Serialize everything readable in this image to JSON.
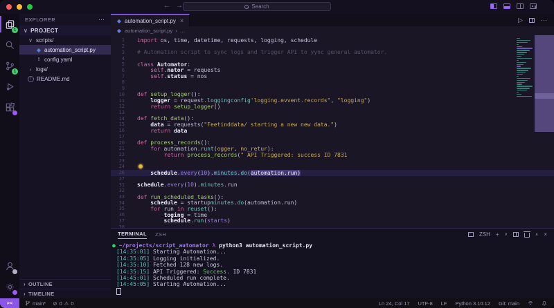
{
  "colors": {
    "accent": "#7c52d6",
    "badge_green": "#3fcf6e",
    "badge_purple": "#9a5cf0",
    "selection": "#453a74"
  },
  "titlebar": {
    "search_placeholder": "Search",
    "nav_back": "←",
    "nav_forward": "→"
  },
  "activity_bar": {
    "explorer_badge": "1",
    "scm_badge": "1"
  },
  "sidebar": {
    "title": "EXPLORER",
    "more": "⋯",
    "project_label": "PROJECT",
    "tree": [
      {
        "label": "scripts/",
        "icon": "folder-open",
        "level": 1
      },
      {
        "label": "automation_script.py",
        "icon": "python",
        "level": 2,
        "selected": true
      },
      {
        "label": "config.yaml",
        "icon": "yaml",
        "level": 2
      },
      {
        "label": "logs/",
        "icon": "folder-closed",
        "level": 1
      },
      {
        "label": "README.md",
        "icon": "info",
        "level": 1
      }
    ],
    "outline_label": "OUTLINE",
    "timeline_label": "TIMELINE"
  },
  "editor": {
    "tab": {
      "label": "automation_script.py",
      "icon": "python",
      "close": "×"
    },
    "actions": {
      "run": "▷",
      "more": "⋯"
    },
    "breadcrumb": {
      "file": "automation_script.py",
      "sep": "›",
      "tail": "…"
    },
    "code": [
      {
        "n": "1",
        "t": [
          [
            "kw",
            "import"
          ],
          [
            "tx",
            " os, time, datetime, requests, logging, schedule"
          ]
        ]
      },
      {
        "n": "2",
        "t": []
      },
      {
        "n": "3",
        "t": [
          [
            "cm",
            "# Automation script to sync logs and trigger API to yync general automator."
          ]
        ]
      },
      {
        "n": "4",
        "t": []
      },
      {
        "n": "5",
        "t": [
          [
            "kw",
            "class"
          ],
          [
            "tx",
            " "
          ],
          [
            "bd",
            "Automator"
          ],
          [
            "tx",
            ":"
          ]
        ]
      },
      {
        "n": "6",
        "t": [
          [
            "tx",
            "    "
          ],
          [
            "sf",
            "self"
          ],
          [
            "tx",
            "."
          ],
          [
            "bd",
            "nator"
          ],
          [
            "tx",
            " = requests"
          ]
        ]
      },
      {
        "n": "7",
        "t": [
          [
            "tx",
            "    "
          ],
          [
            "sf",
            "self"
          ],
          [
            "tx",
            "."
          ],
          [
            "bd",
            "status"
          ],
          [
            "tx",
            " = nos"
          ]
        ]
      },
      {
        "n": "8",
        "t": []
      },
      {
        "n": "9",
        "t": []
      },
      {
        "n": "10",
        "t": [
          [
            "kw",
            "def"
          ],
          [
            "tx",
            " "
          ],
          [
            "fn",
            "setup_logger"
          ],
          [
            "tx",
            "():"
          ]
        ]
      },
      {
        "n": "11",
        "t": [
          [
            "tx",
            "    "
          ],
          [
            "bd",
            "logger"
          ],
          [
            "tx",
            " = request."
          ],
          [
            "pr",
            "loggingconfig"
          ],
          [
            "st",
            "'logging.evvent.records\""
          ],
          [
            "tx",
            ", "
          ],
          [
            "st",
            "\"logging\""
          ],
          [
            "tx",
            ")"
          ]
        ]
      },
      {
        "n": "12",
        "t": [
          [
            "tx",
            "    "
          ],
          [
            "kw",
            "return"
          ],
          [
            "tx",
            " "
          ],
          [
            "fn",
            "setup_logger"
          ],
          [
            "tx",
            "()"
          ]
        ]
      },
      {
        "n": "13",
        "t": []
      },
      {
        "n": "14",
        "t": [
          [
            "kw",
            "def"
          ],
          [
            "tx",
            " "
          ],
          [
            "fn",
            "fetch_data"
          ],
          [
            "tx",
            "():"
          ]
        ]
      },
      {
        "n": "15",
        "t": [
          [
            "tx",
            "    "
          ],
          [
            "bd",
            "data"
          ],
          [
            "tx",
            " = requests("
          ],
          [
            "st",
            "\"Feetinddata/ starting a new new data.\""
          ],
          [
            "tx",
            ")"
          ]
        ]
      },
      {
        "n": "16",
        "t": [
          [
            "tx",
            "    "
          ],
          [
            "kw",
            "return"
          ],
          [
            "tx",
            " "
          ],
          [
            "bd",
            "data"
          ]
        ]
      },
      {
        "n": "17",
        "t": []
      },
      {
        "n": "20",
        "t": [
          [
            "kw",
            "def"
          ],
          [
            "tx",
            " "
          ],
          [
            "fn",
            "process_records"
          ],
          [
            "tx",
            "():"
          ]
        ]
      },
      {
        "n": "21",
        "t": [
          [
            "tx",
            "    "
          ],
          [
            "kw",
            "for"
          ],
          [
            "tx",
            " automation."
          ],
          [
            "pr",
            "runt"
          ],
          [
            "tx",
            "("
          ],
          [
            "st",
            "ogger"
          ],
          [
            "tx",
            ", "
          ],
          [
            "st",
            "no_retur"
          ],
          [
            "tx",
            "):"
          ]
        ]
      },
      {
        "n": "22",
        "t": [
          [
            "tx",
            "        "
          ],
          [
            "kw",
            "return"
          ],
          [
            "tx",
            " "
          ],
          [
            "fn",
            "process_records"
          ],
          [
            "tx",
            "("
          ],
          [
            "st",
            "\" API Triggered: success ID 7831"
          ]
        ]
      },
      {
        "n": "23",
        "t": []
      },
      {
        "n": "24",
        "t": [
          [
            "bulb",
            ""
          ]
        ]
      },
      {
        "n": "26",
        "hl": true,
        "t": [
          [
            "tx",
            "    "
          ],
          [
            "bd",
            "schedule"
          ],
          [
            "tx",
            "."
          ],
          [
            "vi",
            "every"
          ],
          [
            "tx",
            "("
          ],
          [
            "vi",
            "10"
          ],
          [
            "tx",
            ")."
          ],
          [
            "pr",
            "minutes"
          ],
          [
            "tx",
            "."
          ],
          [
            "pr",
            "do"
          ],
          [
            "tx",
            "("
          ],
          [
            "sel",
            "automation.run)"
          ]
        ]
      },
      {
        "n": "27",
        "t": []
      },
      {
        "n": "31",
        "t": [
          [
            "bd",
            "schedule"
          ],
          [
            "tx",
            "."
          ],
          [
            "vi",
            "every"
          ],
          [
            "tx",
            "("
          ],
          [
            "vi",
            "10"
          ],
          [
            "tx",
            ")."
          ],
          [
            "pr",
            "minutes"
          ],
          [
            "tx",
            "."
          ],
          [
            "tx",
            "run"
          ]
        ]
      },
      {
        "n": "32",
        "t": []
      },
      {
        "n": "33",
        "t": [
          [
            "kw",
            "def"
          ],
          [
            "tx",
            " "
          ],
          [
            "fn",
            "run_scheduled_tasks"
          ],
          [
            "tx",
            "():"
          ]
        ]
      },
      {
        "n": "34",
        "t": [
          [
            "tx",
            "    "
          ],
          [
            "bd",
            "schedule"
          ],
          [
            "tx",
            " = startup"
          ],
          [
            "pr",
            "minutes"
          ],
          [
            "tx",
            "."
          ],
          [
            "pr",
            "do"
          ],
          [
            "tx",
            "(automation.run)"
          ]
        ]
      },
      {
        "n": "35",
        "t": [
          [
            "tx",
            "    "
          ],
          [
            "kw",
            "for"
          ],
          [
            "tx",
            " run "
          ],
          [
            "kw",
            "in"
          ],
          [
            "tx",
            " "
          ],
          [
            "pr",
            "reuset"
          ],
          [
            "tx",
            "():"
          ]
        ]
      },
      {
        "n": "36",
        "t": [
          [
            "tx",
            "        "
          ],
          [
            "bd",
            "toging"
          ],
          [
            "tx",
            " = time"
          ]
        ]
      },
      {
        "n": "37",
        "t": [
          [
            "tx",
            "        "
          ],
          [
            "bd",
            "schedule"
          ],
          [
            "tx",
            "."
          ],
          [
            "pr",
            "run"
          ],
          [
            "tx",
            "("
          ],
          [
            "vi",
            "starts"
          ],
          [
            "tx",
            ")"
          ]
        ]
      },
      {
        "n": "38",
        "t": []
      }
    ]
  },
  "terminal": {
    "tab_terminal": "TERMINAL",
    "tab_zsh": "ZSH",
    "profile_label": "ZSH",
    "actions": {
      "new": "+",
      "chevron": "∨",
      "maximize": "∧",
      "close": "×"
    },
    "lines": [
      [
        [
          "dot",
          "●"
        ],
        [
          "path",
          " ~/projects/script_automator"
        ],
        [
          "lam",
          " λ"
        ],
        [
          "cmd",
          " python3 automation_script.py"
        ]
      ],
      [
        [
          "tm",
          "[14:35:01]"
        ],
        [
          "tt",
          " Starting Automation..."
        ]
      ],
      [
        [
          "tm",
          "[14:35:05]"
        ],
        [
          "tt",
          " Logging initialized."
        ]
      ],
      [
        [
          "tm",
          "[14:35:10]"
        ],
        [
          "tt",
          " Fetched 128 new logs."
        ]
      ],
      [
        [
          "tm",
          "[14:35:15]"
        ],
        [
          "tt",
          " API Triggered: "
        ],
        [
          "ok",
          "Success."
        ],
        [
          "tt",
          " ID 7831"
        ]
      ],
      [
        [
          "tm",
          "[14:45:01]"
        ],
        [
          "tt",
          " Scheduled run complete."
        ]
      ],
      [
        [
          "tm",
          "[14:45:05]"
        ],
        [
          "tt",
          " Starting Automation..."
        ]
      ],
      [
        [
          "cur",
          ""
        ]
      ]
    ]
  },
  "status_bar": {
    "remote_icon": "><",
    "branch": "main*",
    "errors": "0",
    "warnings": "0",
    "right": [
      "Ln 24, Col 17",
      "UTF-8",
      "LF",
      "Python 3.10.12",
      "Git: main"
    ]
  }
}
